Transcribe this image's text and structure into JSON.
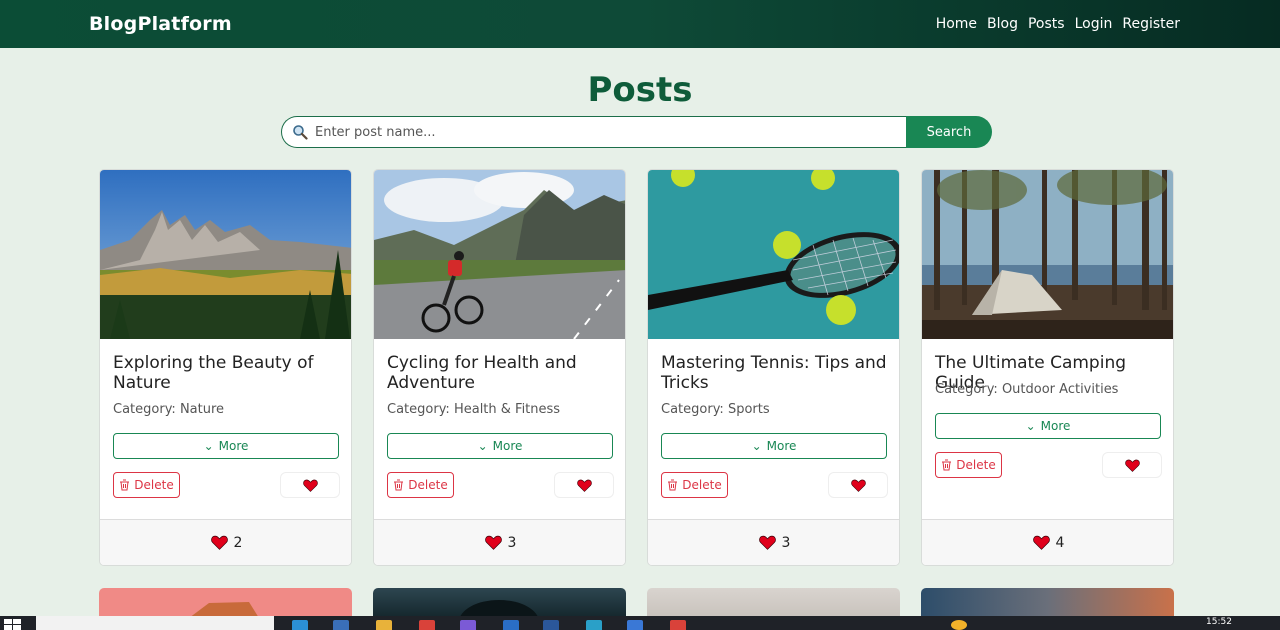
{
  "navbar": {
    "brand": "BlogPlatform",
    "links": [
      "Home",
      "Blog",
      "Posts",
      "Login",
      "Register"
    ]
  },
  "page": {
    "title": "Posts",
    "search_placeholder": "Enter post name...",
    "search_button": "Search"
  },
  "posts": [
    {
      "title": "Exploring the Beauty of Nature",
      "category": "Category: Nature",
      "likes": "2"
    },
    {
      "title": "Cycling for Health and Adventure",
      "category": "Category: Health & Fitness",
      "likes": "3"
    },
    {
      "title": "Mastering Tennis: Tips and Tricks",
      "category": "Category: Sports",
      "likes": "3"
    },
    {
      "title": "The Ultimate Camping Guide",
      "category": "Category: Outdoor Activities",
      "likes": "4"
    }
  ],
  "buttons": {
    "more": "More",
    "delete": "Delete"
  },
  "taskbar": {
    "time": "15:52"
  },
  "colors": {
    "accent": "#198754",
    "danger": "#dc3545",
    "heart": "#e0001b",
    "title_green": "#0e5c3a",
    "background": "#e7f0e8"
  }
}
